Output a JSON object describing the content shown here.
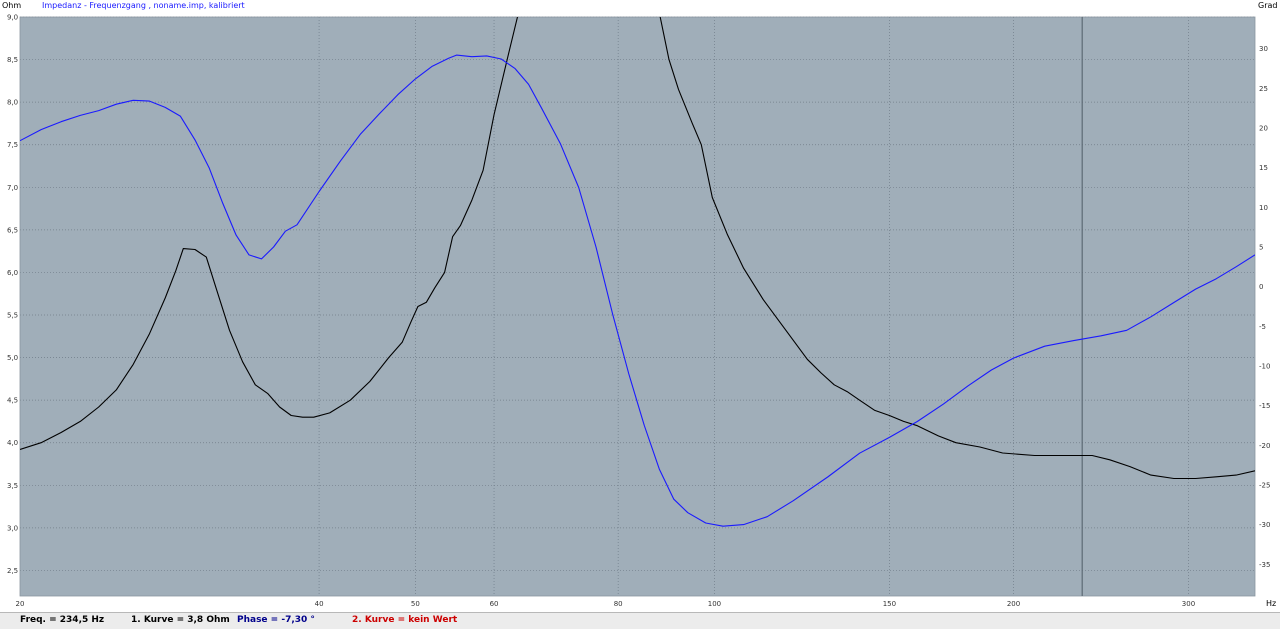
{
  "chart_data": {
    "type": "line",
    "title": "Impedanz - Frequenzgang , noname.imp, kalibriert",
    "x_unit": "Hz",
    "y_left_unit": "Ohm",
    "y_right_unit": "Grad",
    "x_scale": "log",
    "xlim": [
      20,
      350
    ],
    "ylim_left": [
      2.2,
      9.0
    ],
    "ylim_right": [
      -39,
      34
    ],
    "x_ticks": [
      "20",
      "40",
      "50",
      "60",
      "80",
      "100",
      "150",
      "200",
      "300"
    ],
    "y_left_ticks": [
      "9,0",
      "8,5",
      "8,0",
      "7,5",
      "7,0",
      "6,5",
      "6,0",
      "5,5",
      "5,0",
      "4,5",
      "4,0",
      "3,5",
      "3,0",
      "2,5"
    ],
    "y_right_ticks": [
      "30",
      "25",
      "20",
      "15",
      "10",
      "5",
      "0",
      "-5",
      "-10",
      "-15",
      "-20",
      "-25",
      "-30",
      "-35"
    ],
    "grid": true,
    "cursor_x": 234.5,
    "colors": {
      "background": "#a0aeb9",
      "impedance": "#000000",
      "phase": "#1a1aff",
      "grid": "#6f7c88",
      "cursor": "#5d6a74"
    },
    "series": [
      {
        "axis": "left",
        "color": "#000000",
        "points": [
          [
            20,
            3.92
          ],
          [
            21,
            4.0
          ],
          [
            22,
            4.12
          ],
          [
            23,
            4.25
          ],
          [
            24,
            4.42
          ],
          [
            25,
            4.62
          ],
          [
            26,
            4.92
          ],
          [
            27,
            5.28
          ],
          [
            28,
            5.7
          ],
          [
            28.7,
            6.02
          ],
          [
            29.2,
            6.28
          ],
          [
            30,
            6.27
          ],
          [
            30.8,
            6.18
          ],
          [
            31.5,
            5.82
          ],
          [
            32.5,
            5.32
          ],
          [
            33.5,
            4.95
          ],
          [
            34.5,
            4.68
          ],
          [
            35.5,
            4.58
          ],
          [
            36.5,
            4.42
          ],
          [
            37.5,
            4.32
          ],
          [
            38.5,
            4.3
          ],
          [
            39.5,
            4.3
          ],
          [
            41,
            4.35
          ],
          [
            43,
            4.5
          ],
          [
            45,
            4.72
          ],
          [
            47,
            5.0
          ],
          [
            48.5,
            5.18
          ],
          [
            49.5,
            5.42
          ],
          [
            50.3,
            5.6
          ],
          [
            51.3,
            5.65
          ],
          [
            52.3,
            5.82
          ],
          [
            53.5,
            6.0
          ],
          [
            54.5,
            6.42
          ],
          [
            55.5,
            6.55
          ],
          [
            57,
            6.85
          ],
          [
            58.5,
            7.2
          ],
          [
            60,
            7.85
          ],
          [
            62,
            8.55
          ],
          [
            63.5,
            9.05
          ],
          [
            88,
            9.05
          ],
          [
            90,
            8.5
          ],
          [
            92,
            8.15
          ],
          [
            95,
            7.75
          ],
          [
            97,
            7.5
          ],
          [
            99.5,
            6.88
          ],
          [
            103,
            6.45
          ],
          [
            107,
            6.05
          ],
          [
            112,
            5.68
          ],
          [
            118,
            5.32
          ],
          [
            124,
            4.98
          ],
          [
            128,
            4.82
          ],
          [
            132,
            4.68
          ],
          [
            136,
            4.6
          ],
          [
            140,
            4.5
          ],
          [
            145,
            4.38
          ],
          [
            150,
            4.32
          ],
          [
            155,
            4.25
          ],
          [
            160,
            4.2
          ],
          [
            168,
            4.08
          ],
          [
            175,
            4.0
          ],
          [
            185,
            3.95
          ],
          [
            195,
            3.88
          ],
          [
            210,
            3.85
          ],
          [
            225,
            3.85
          ],
          [
            240,
            3.85
          ],
          [
            250,
            3.8
          ],
          [
            262,
            3.72
          ],
          [
            275,
            3.62
          ],
          [
            290,
            3.58
          ],
          [
            305,
            3.58
          ],
          [
            320,
            3.6
          ],
          [
            335,
            3.62
          ],
          [
            350,
            3.67
          ]
        ]
      },
      {
        "axis": "right",
        "color": "#1a1aff",
        "points": [
          [
            20,
            18.4
          ],
          [
            21,
            19.8
          ],
          [
            22,
            20.8
          ],
          [
            23,
            21.6
          ],
          [
            24,
            22.2
          ],
          [
            25,
            23.0
          ],
          [
            26,
            23.5
          ],
          [
            27,
            23.4
          ],
          [
            28,
            22.6
          ],
          [
            29,
            21.5
          ],
          [
            30,
            18.5
          ],
          [
            31,
            15.0
          ],
          [
            32,
            10.5
          ],
          [
            33,
            6.5
          ],
          [
            34,
            4.0
          ],
          [
            35,
            3.5
          ],
          [
            36,
            5.0
          ],
          [
            37,
            7.0
          ],
          [
            38,
            7.8
          ],
          [
            40,
            12.0
          ],
          [
            42,
            15.8
          ],
          [
            44,
            19.2
          ],
          [
            46,
            21.8
          ],
          [
            48,
            24.2
          ],
          [
            50,
            26.2
          ],
          [
            52,
            27.8
          ],
          [
            54,
            28.8
          ],
          [
            55,
            29.2
          ],
          [
            57,
            29.0
          ],
          [
            59,
            29.1
          ],
          [
            61,
            28.7
          ],
          [
            63,
            27.5
          ],
          [
            65,
            25.5
          ],
          [
            67,
            22.5
          ],
          [
            70,
            18.0
          ],
          [
            73,
            12.5
          ],
          [
            76,
            5.0
          ],
          [
            79,
            -3.5
          ],
          [
            82,
            -11.0
          ],
          [
            85,
            -17.5
          ],
          [
            88,
            -23.0
          ],
          [
            91,
            -26.8
          ],
          [
            94,
            -28.5
          ],
          [
            98,
            -29.8
          ],
          [
            102,
            -30.2
          ],
          [
            107,
            -30.0
          ],
          [
            113,
            -29.0
          ],
          [
            120,
            -27.0
          ],
          [
            130,
            -24.0
          ],
          [
            140,
            -21.0
          ],
          [
            150,
            -19.0
          ],
          [
            160,
            -17.0
          ],
          [
            170,
            -14.8
          ],
          [
            180,
            -12.5
          ],
          [
            190,
            -10.5
          ],
          [
            200,
            -9.0
          ],
          [
            215,
            -7.5
          ],
          [
            230,
            -6.8
          ],
          [
            245,
            -6.2
          ],
          [
            260,
            -5.5
          ],
          [
            275,
            -3.8
          ],
          [
            290,
            -2.0
          ],
          [
            305,
            -0.3
          ],
          [
            320,
            1.0
          ],
          [
            335,
            2.5
          ],
          [
            350,
            4.0
          ]
        ]
      }
    ]
  },
  "status": {
    "freq": "Freq. = 234,5 Hz",
    "curve1": "1. Kurve = 3,8 Ohm",
    "phase": "Phase = -7,30 °",
    "curve2": "2. Kurve = kein Wert"
  }
}
